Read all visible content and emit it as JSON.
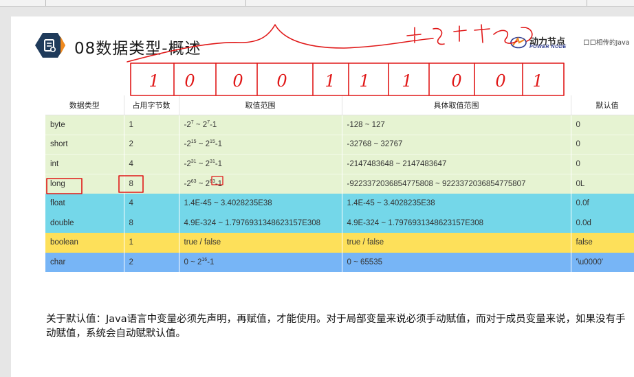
{
  "slide": {
    "title": "08数据类型-概述",
    "logo": {
      "brand": "动力节点",
      "sub": "POWER NODE",
      "slogan": "口口相传的Java"
    },
    "table": {
      "headers": [
        "数据类型",
        "占用字节数",
        "取值范围",
        "具体取值范围",
        "默认值"
      ],
      "rows": [
        {
          "type": "byte",
          "bytes": "1",
          "range_base": "-2",
          "range_exp": "7",
          "range_mid": " ~ 2",
          "range_exp2": "7",
          "range_tail": "-1",
          "concrete": "-128 ~ 127",
          "default": "0",
          "color": "green"
        },
        {
          "type": "short",
          "bytes": "2",
          "range_base": "-2",
          "range_exp": "15",
          "range_mid": " ~ 2",
          "range_exp2": "15",
          "range_tail": "-1",
          "concrete": "-32768 ~ 32767",
          "default": "0",
          "color": "green"
        },
        {
          "type": "int",
          "bytes": "4",
          "range_base": "-2",
          "range_exp": "31",
          "range_mid": " ~ 2",
          "range_exp2": "31",
          "range_tail": "-1",
          "concrete": "-2147483648 ~ 2147483647",
          "default": "0",
          "color": "green"
        },
        {
          "type": "long",
          "bytes": "8",
          "range_base": "-2",
          "range_exp": "63",
          "range_mid": " ~ 2",
          "range_exp2": "63",
          "range_tail": "-1",
          "concrete": "-9223372036854775808 ~ 9223372036854775807",
          "default": "0L",
          "color": "green"
        },
        {
          "type": "float",
          "bytes": "4",
          "range_text": "1.4E-45 ~ 3.4028235E38",
          "concrete": "1.4E-45 ~ 3.4028235E38",
          "default": "0.0f",
          "color": "cyan"
        },
        {
          "type": "double",
          "bytes": "8",
          "range_text": "4.9E-324 ~ 1.7976931348623157E308",
          "concrete": "4.9E-324 ~ 1.7976931348623157E308",
          "default": "0.0d",
          "color": "cyan"
        },
        {
          "type": "boolean",
          "bytes": "1",
          "range_text": "true / false",
          "concrete": "true / false",
          "default": "false",
          "color": "yellow"
        },
        {
          "type": "char",
          "bytes": "2",
          "range_base": "0 ~ 2",
          "range_exp": "16",
          "range_mid": "-1",
          "concrete": "0 ~ 65535",
          "default": "'\\u0000'",
          "color": "blue"
        }
      ]
    },
    "note": "关于默认值：Java语言中变量必须先声明，再赋值，才能使用。对于局部变量来说必须手动赋值，而对于成员变量来说，如果没有手动赋值，系统会自动赋默认值。"
  },
  "annotation": {
    "bits": [
      "1",
      "0",
      "0",
      "0",
      "1",
      "1",
      "1",
      "0",
      "0",
      "1"
    ],
    "ink_color": "#e01818"
  },
  "colors": {
    "green_row": "#e6f3d2",
    "cyan_row": "#74d7e9",
    "yellow_row": "#fde05a",
    "blue_row": "#77b5f6",
    "title_icon": "#1f3b5b",
    "accent": "#f08a1e"
  }
}
